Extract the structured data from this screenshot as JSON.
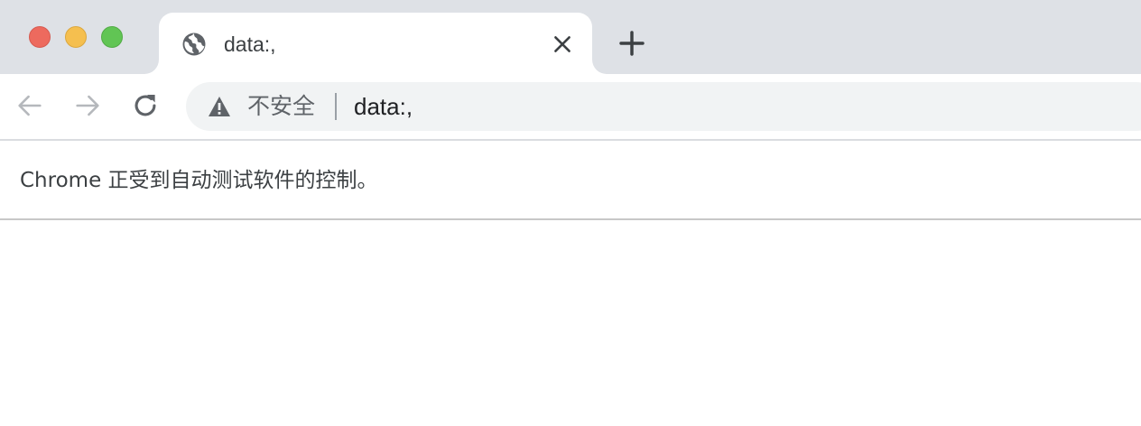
{
  "window": {
    "controls": [
      "close",
      "minimize",
      "maximize"
    ]
  },
  "tab": {
    "favicon": "globe-icon",
    "title": "data:,",
    "close_icon": "close-icon"
  },
  "new_tab": {
    "icon": "plus-icon"
  },
  "toolbar": {
    "back_icon": "arrow-left-icon",
    "forward_icon": "arrow-right-icon",
    "reload_icon": "reload-icon"
  },
  "omnibox": {
    "security_icon": "warning-icon",
    "security_label": "不安全",
    "url": "data:,"
  },
  "infobar": {
    "message": "Chrome 正受到自动测试软件的控制。"
  },
  "colors": {
    "tabstrip_bg": "#dee1e6",
    "omnibox_bg": "#f1f3f4",
    "traffic_close": "#ed6a5e",
    "traffic_min": "#f5bf4f",
    "traffic_max": "#61c554"
  }
}
